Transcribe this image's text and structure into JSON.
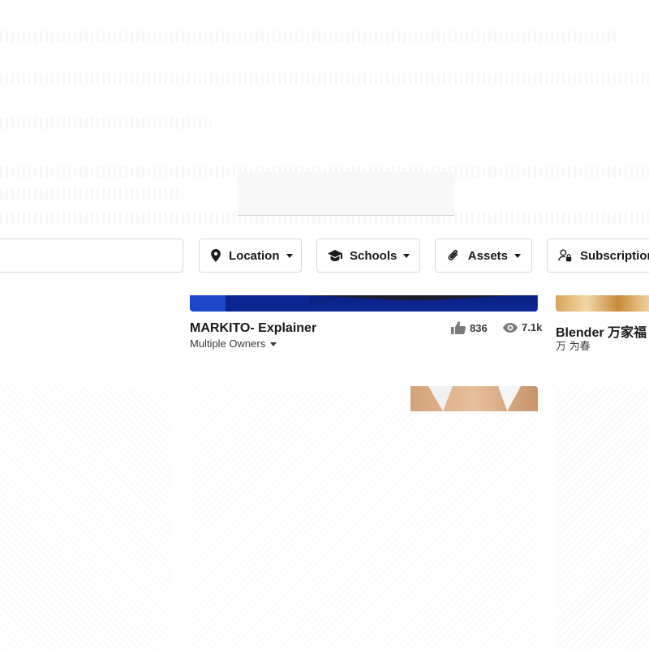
{
  "search": {
    "placeholder": ""
  },
  "filters": [
    {
      "label": "Location",
      "icon": "location-pin-icon"
    },
    {
      "label": "Schools",
      "icon": "graduation-cap-icon"
    },
    {
      "label": "Assets",
      "icon": "paperclip-icon"
    },
    {
      "label": "Subscription",
      "icon": "user-lock-icon"
    }
  ],
  "cards": [
    {
      "title": "MARKITO- Explainer",
      "owner": "Multiple Owners",
      "likes": "836",
      "views": "7.1k"
    },
    {
      "title": "Blender 万家福",
      "owner": "万 为春"
    }
  ],
  "colors": {
    "text": "#191919",
    "border": "#d9d9d9",
    "thumb_blue": "#1d47c9"
  }
}
